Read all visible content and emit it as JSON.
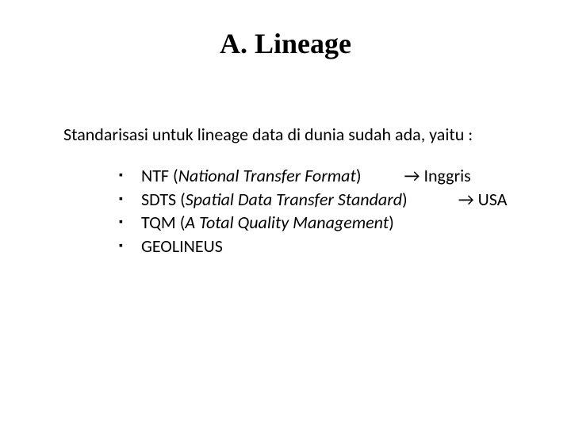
{
  "title": "A. Lineage",
  "intro": "Standarisasi untuk lineage data di dunia sudah ada, yaitu :",
  "bullets": [
    {
      "abbr": "NTF",
      "expansion": "National Transfer Format",
      "arrow": "→",
      "country": "Inggris"
    },
    {
      "abbr": "SDTS",
      "expansion": "Spatial Data Transfer Standard",
      "arrow": "→",
      "country": "USA"
    },
    {
      "abbr": "TQM",
      "expansion": "A Total Quality Management",
      "arrow": "",
      "country": ""
    },
    {
      "abbr": "GEOLINEUS",
      "expansion": "",
      "arrow": "",
      "country": ""
    }
  ]
}
